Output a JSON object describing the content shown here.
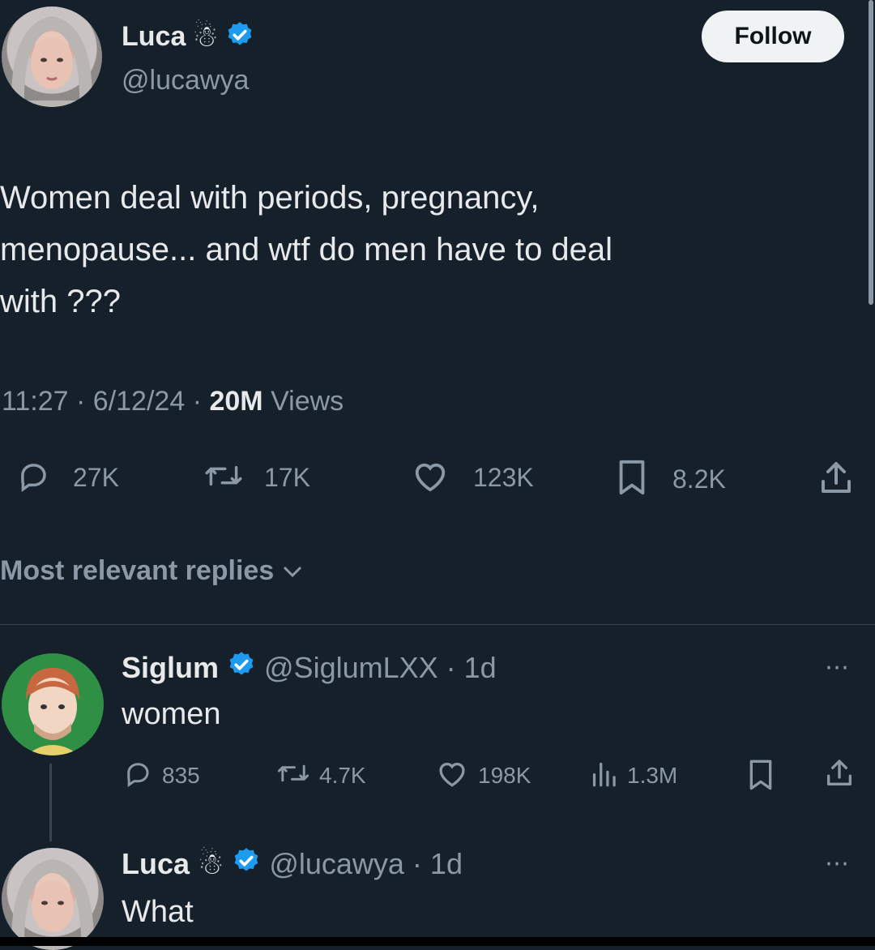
{
  "tweet": {
    "author_name": "Luca",
    "author_emoji": "☃",
    "author_handle": "@lucawya",
    "follow_label": "Follow",
    "text_lines": [
      "Women deal with periods, pregnancy,",
      "menopause... and wtf do men have to deal",
      "with ???"
    ],
    "time": "11:27",
    "date": "6/12/24",
    "views_count": "20M",
    "views_label": "Views",
    "replies": "27K",
    "reposts": "17K",
    "likes": "123K",
    "bookmarks": "8.2K"
  },
  "sort": {
    "label": "Most relevant replies"
  },
  "reply1": {
    "author_name": "Siglum",
    "author_handle": "@SiglumLXX",
    "age": "1d",
    "text": "women",
    "replies": "835",
    "reposts": "4.7K",
    "likes": "198K",
    "views": "1.3M"
  },
  "reply2": {
    "author_name": "Luca",
    "author_emoji": "☃",
    "author_handle": "@lucawya",
    "age": "1d",
    "text": "What"
  },
  "colors": {
    "background": "#15202b",
    "text": "#e7e9ea",
    "muted": "#8b98a5",
    "verified": "#1d9bf0"
  },
  "icons": [
    "verified-icon",
    "snowman-icon",
    "reply-icon",
    "repost-icon",
    "like-icon",
    "bookmark-icon",
    "share-icon",
    "views-icon",
    "more-icon",
    "chevron-down-icon"
  ]
}
